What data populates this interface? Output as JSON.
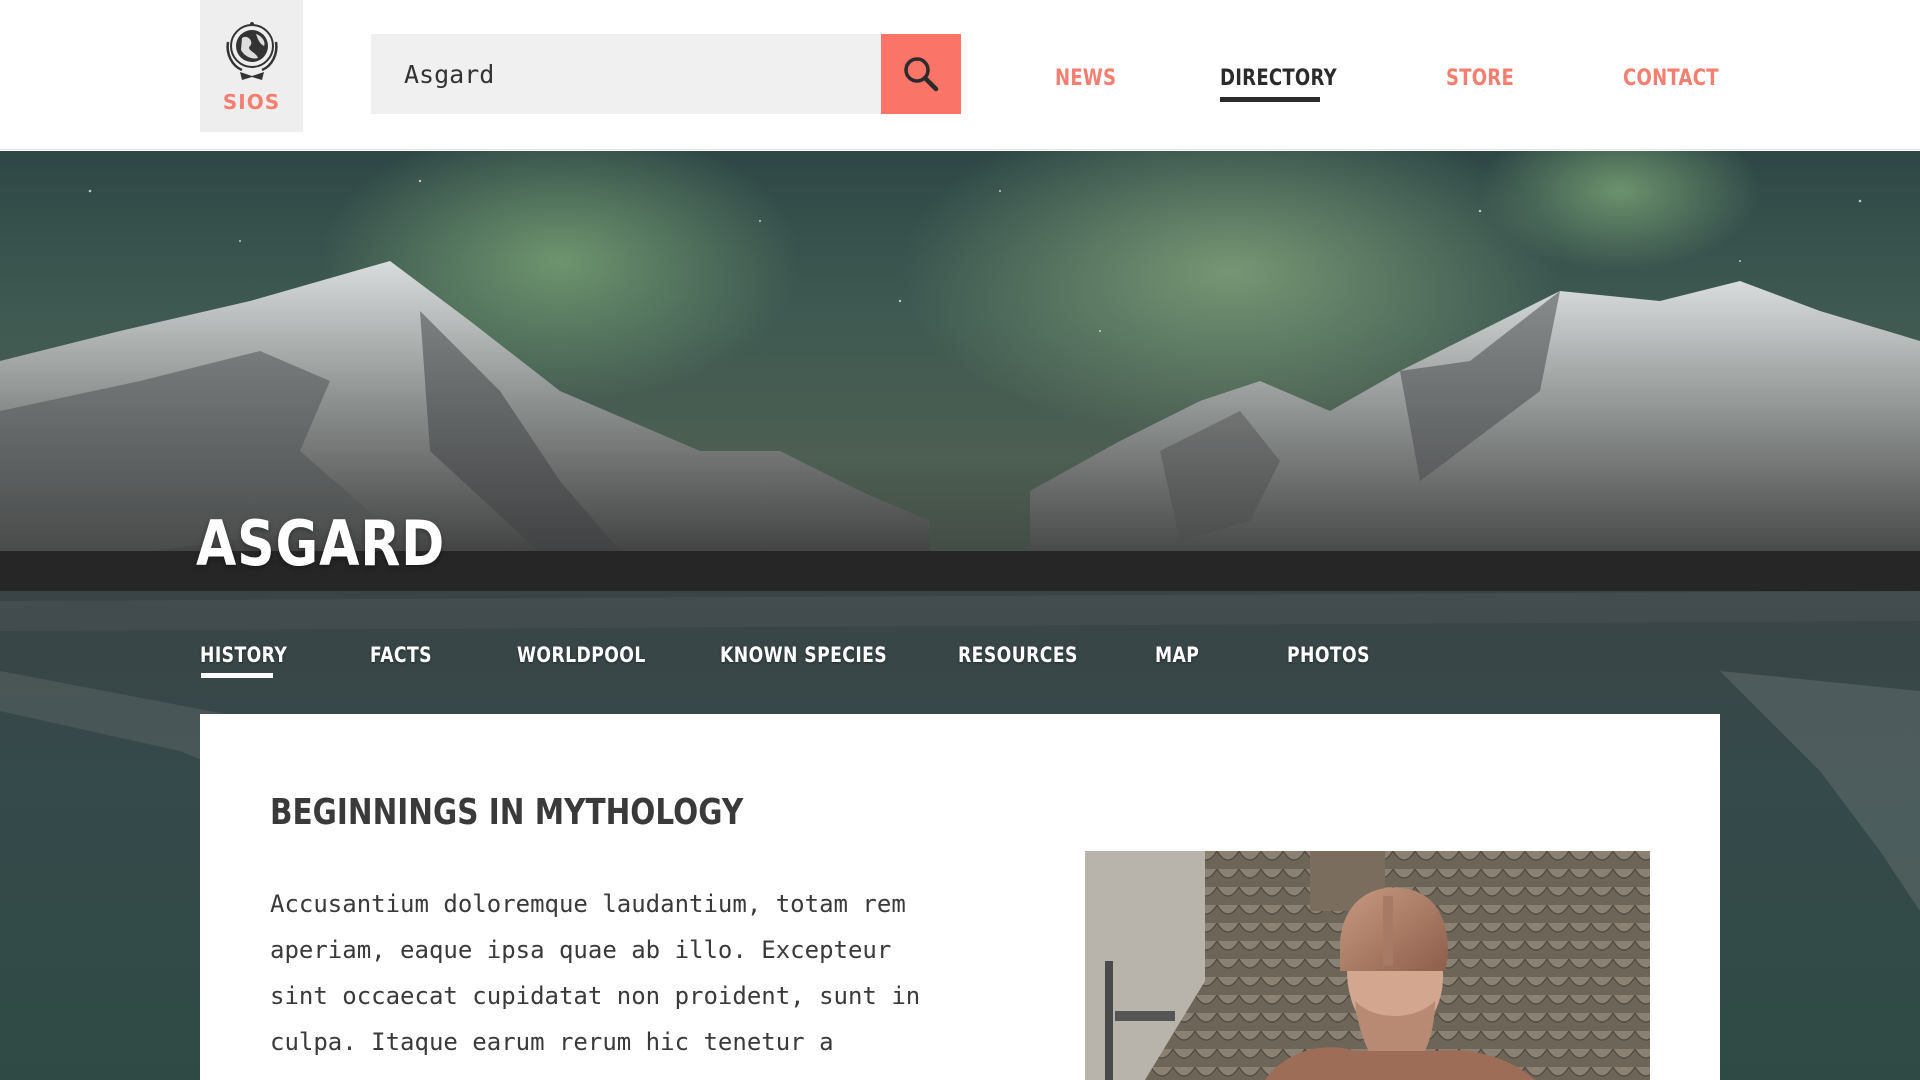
{
  "brand": {
    "logo_text": "SIOS",
    "logo_icon": "globe-emblem-icon"
  },
  "search": {
    "value": "Asgard",
    "button_icon": "search-icon"
  },
  "topnav": {
    "items": [
      {
        "label": "NEWS",
        "active": false
      },
      {
        "label": "DIRECTORY",
        "active": true
      },
      {
        "label": "STORE",
        "active": false
      },
      {
        "label": "CONTACT",
        "active": false
      }
    ]
  },
  "hero": {
    "title": "ASGARD",
    "tabs": [
      {
        "label": "HISTORY",
        "active": true
      },
      {
        "label": "FACTS",
        "active": false
      },
      {
        "label": "WORLDPOOL",
        "active": false
      },
      {
        "label": "KNOWN SPECIES",
        "active": false
      },
      {
        "label": "RESOURCES",
        "active": false
      },
      {
        "label": "MAP",
        "active": false
      },
      {
        "label": "PHOTOS",
        "active": false
      }
    ]
  },
  "article": {
    "heading": "BEGINNINGS IN MYTHOLOGY",
    "lines": [
      "Accusantium doloremque laudantium, totam rem",
      "aperiam, eaque ipsa quae ab illo. Excepteur",
      "sint occaecat cupidatat non proident, sunt in",
      "culpa. Itaque earum rerum hic tenetur a"
    ]
  },
  "colors": {
    "accent": "#fb7468",
    "accent_text": "#f47e70",
    "dark_text": "#2b2b2b",
    "search_bg": "#f0f0f0"
  }
}
